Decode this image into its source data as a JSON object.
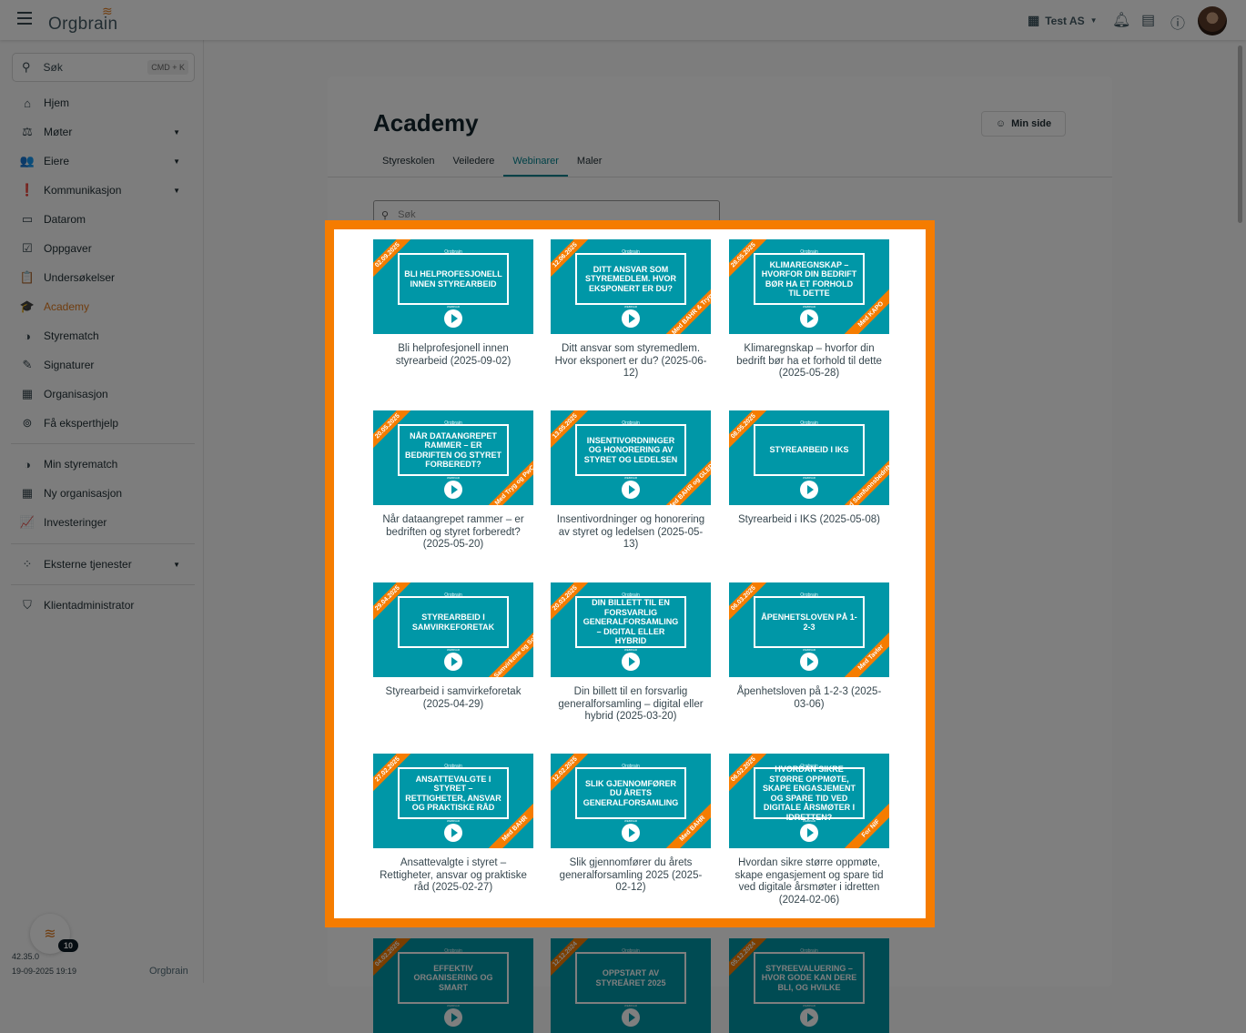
{
  "topbar": {
    "logo": "Orgbrain",
    "org": "Test AS"
  },
  "sidebar": {
    "search_placeholder": "Søk",
    "shortcut": "CMD + K",
    "items": [
      {
        "label": "Hjem",
        "icon": "home-icon",
        "glyph": "⌂"
      },
      {
        "label": "Møter",
        "icon": "gavel-icon",
        "glyph": "⚖",
        "caret": true
      },
      {
        "label": "Eiere",
        "icon": "people-icon",
        "glyph": "👥",
        "caret": true
      },
      {
        "label": "Kommunikasjon",
        "icon": "announcement-icon",
        "glyph": "❗",
        "caret": true
      },
      {
        "label": "Datarom",
        "icon": "folder-icon",
        "glyph": "▭"
      },
      {
        "label": "Oppgaver",
        "icon": "task-icon",
        "glyph": "☑"
      },
      {
        "label": "Undersøkelser",
        "icon": "clipboard-icon",
        "glyph": "📋"
      },
      {
        "label": "Academy",
        "icon": "school-icon",
        "glyph": "🎓",
        "active": true
      },
      {
        "label": "Styrematch",
        "icon": "match-icon",
        "glyph": "◑"
      },
      {
        "label": "Signaturer",
        "icon": "signature-icon",
        "glyph": "✎"
      },
      {
        "label": "Organisasjon",
        "icon": "building-icon",
        "glyph": "▦"
      },
      {
        "label": "Få eksperthjelp",
        "icon": "expert-icon",
        "glyph": "⊚"
      }
    ],
    "items2": [
      {
        "label": "Min styrematch",
        "icon": "match-icon",
        "glyph": "◑"
      },
      {
        "label": "Ny organisasjon",
        "icon": "add-building-icon",
        "glyph": "▦"
      },
      {
        "label": "Investeringer",
        "icon": "chart-icon",
        "glyph": "📈"
      }
    ],
    "items3": [
      {
        "label": "Eksterne tjenester",
        "icon": "services-icon",
        "glyph": "⁘",
        "caret": true
      }
    ],
    "items4": [
      {
        "label": "Klientadministrator",
        "icon": "shield-icon",
        "glyph": "⛉"
      }
    ],
    "badge": "10",
    "version": "42.35.0",
    "timestamp": "19-09-2025 19:19"
  },
  "main": {
    "title": "Academy",
    "min_side": "Min side",
    "tabs": [
      "Styreskolen",
      "Veiledere",
      "Webinarer",
      "Maler"
    ],
    "active_tab": 2,
    "search_placeholder": "Søk",
    "webinars": [
      {
        "title": "BLI HELPROFESJONELL INNEN STYREARBEID",
        "caption": "Bli helprofesjonell innen styrearbeid (2025-09-02)",
        "date": "02.09.2025",
        "sponsor": ""
      },
      {
        "title": "DITT ANSVAR SOM STYREMEDLEM. HVOR EKSPONERT ER DU?",
        "caption": "Ditt ansvar som styremedlem. Hvor eksponert er du? (2025-06-12)",
        "date": "12.06.2025",
        "sponsor": "Med BAHR & Tryg"
      },
      {
        "title": "KLIMAREGNSKAP – HVORFOR DIN BEDRIFT BØR HA ET FORHOLD TIL DETTE",
        "caption": "Klimaregnskap – hvorfor din bedrift bør ha et forhold til dette (2025-05-28)",
        "date": "28.05.2025",
        "sponsor": "Med KAPO"
      },
      {
        "title": "NÅR DATAANGREPET RAMMER – ER BEDRIFTEN OG STYRET FORBEREDT?",
        "caption": "Når dataangrepet rammer – er bedriften og styret forberedt? (2025-05-20)",
        "date": "20.05.2025",
        "sponsor": "Med Tryg og PwC"
      },
      {
        "title": "INSENTIVORDNINGER OG HONORERING AV STYRET OG LEDELSEN",
        "caption": "Insentivordninger og honorering av styret og ledelsen (2025-05-13)",
        "date": "13.05.2025",
        "sponsor": "Med BAHR og GLEDE"
      },
      {
        "title": "STYREARBEID I IKS",
        "caption": "Styrearbeid i IKS (2025-05-08)",
        "date": "08.05.2025",
        "sponsor": "Med Samfunnsbedriftene"
      },
      {
        "title": "STYREARBEID I SAMVIRKEFORETAK",
        "caption": "Styrearbeid i samvirkeforetak (2025-04-29)",
        "date": "29.04.2025",
        "sponsor": "Med Samvirkene og Schjødt"
      },
      {
        "title": "DIN BILLETT TIL EN FORSVARLIG GENERALFORSAMLING – DIGITAL ELLER HYBRID",
        "caption": "Din billett til en forsvarlig generalforsamling – digital eller hybrid (2025-03-20)",
        "date": "20.03.2025",
        "sponsor": ""
      },
      {
        "title": "ÅPENHETSLOVEN PÅ 1-2-3",
        "caption": "Åpenhetsloven på 1-2-3 (2025-03-06)",
        "date": "06.03.2025",
        "sponsor": "Med Tavler"
      },
      {
        "title": "ANSATTEVALGTE I STYRET – RETTIGHETER, ANSVAR OG PRAKTISKE RÅD",
        "caption": "Ansattevalgte i styret – Rettigheter, ansvar og praktiske råd (2025-02-27)",
        "date": "27.02.2025",
        "sponsor": "Med BAHR"
      },
      {
        "title": "SLIK GJENNOMFØRER DU ÅRETS GENERALFORSAMLING",
        "caption": "Slik gjennomfører du årets generalforsamling 2025 (2025-02-12)",
        "date": "12.02.2025",
        "sponsor": "Med BAHR"
      },
      {
        "title": "HVORDAN SIKRE STØRRE OPPMØTE, SKAPE ENGASJEMENT OG SPARE TID VED DIGITALE ÅRSMØTER I IDRETTEN?",
        "caption": "Hvordan sikre større oppmøte, skape engasjement og spare tid ved digitale årsmøter i idretten (2024-02-06)",
        "date": "06.02.2025",
        "sponsor": "For NIF"
      },
      {
        "title": "EFFEKTIV ORGANISERING OG SMART",
        "caption": "",
        "date": "04.02.2025",
        "sponsor": ""
      },
      {
        "title": "OPPSTART AV STYREÅRET 2025",
        "caption": "",
        "date": "12.12.2024",
        "sponsor": ""
      },
      {
        "title": "STYREEVALUERING – HVOR GODE KAN DERE BLI, OG HVILKE",
        "caption": "",
        "date": "05.12.2024",
        "sponsor": ""
      }
    ],
    "thumb_logo": "Orgbrain",
    "thumb_label": "WEBINAR"
  },
  "colors": {
    "accent": "#e07a1f",
    "teal": "#0097a7",
    "highlight": "#f57c00"
  }
}
